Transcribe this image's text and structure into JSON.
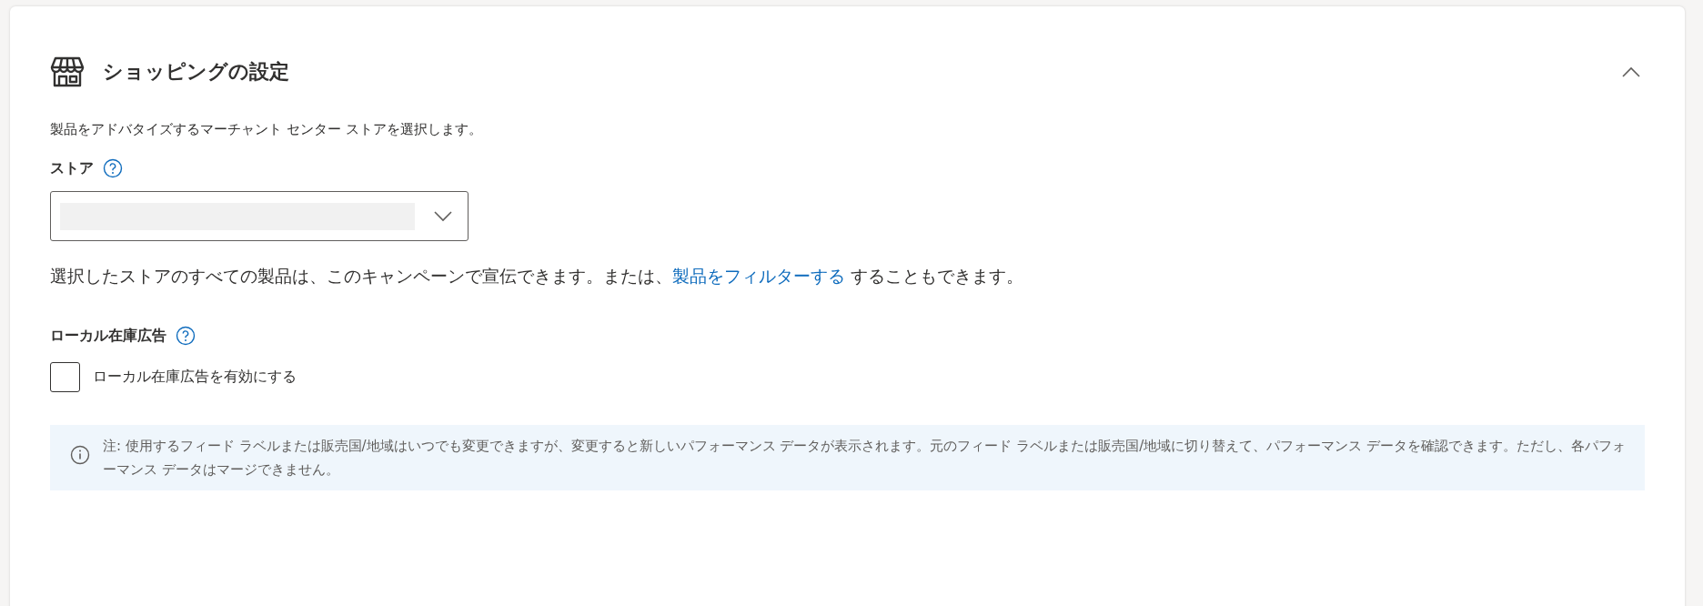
{
  "section": {
    "title": "ショッピングの設定",
    "expanded": true,
    "description": "製品をアドバタイズするマーチャント センター ストアを選択します。",
    "store": {
      "label": "ストア"
    },
    "store_note": {
      "before": "選択したストアのすべての製品は、このキャンペーンで宣伝できます。または、",
      "link": "製品をフィルターする",
      "after": " することもできます。"
    },
    "local_inventory": {
      "label": "ローカル在庫広告",
      "checkbox": {
        "label": "ローカル在庫広告を有効にする",
        "checked": false
      }
    },
    "info": "注: 使用するフィード ラベルまたは販売国/地域はいつでも変更できますが、変更すると新しいパフォーマンス データが表示されます。元のフィード ラベルまたは販売国/地域に切り替えて、パフォーマンス データを確認できます。ただし、各パフォーマンス データはマージできません。"
  }
}
